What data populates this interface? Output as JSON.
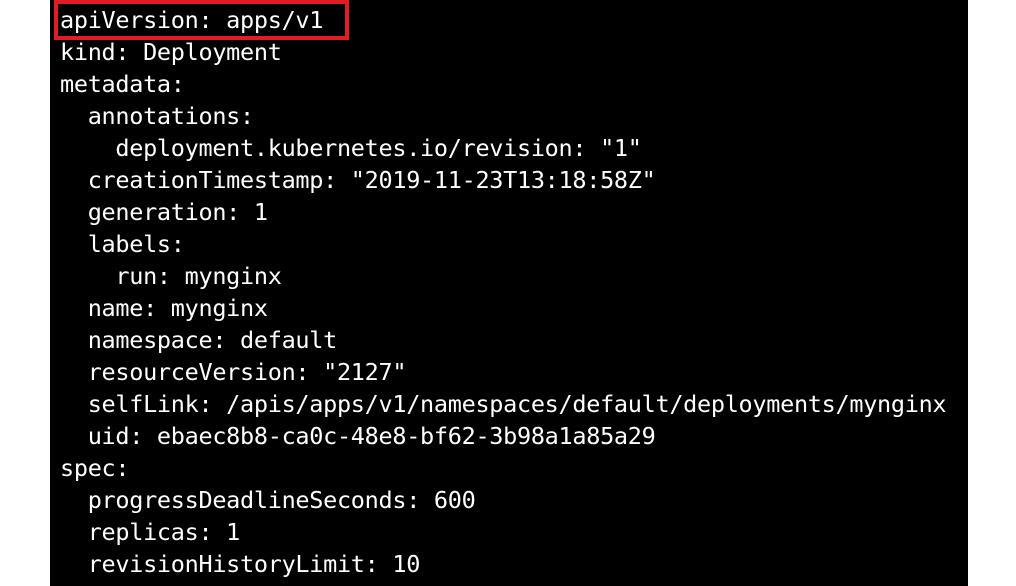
{
  "terminal": {
    "highlight_color": "#e01c24",
    "lines": [
      "apiVersion: apps/v1",
      "kind: Deployment",
      "metadata:",
      "  annotations:",
      "    deployment.kubernetes.io/revision: \"1\"",
      "  creationTimestamp: \"2019-11-23T13:18:58Z\"",
      "  generation: 1",
      "  labels:",
      "    run: mynginx",
      "  name: mynginx",
      "  namespace: default",
      "  resourceVersion: \"2127\"",
      "  selfLink: /apis/apps/v1/namespaces/default/deployments/mynginx",
      "  uid: ebaec8b8-ca0c-48e8-bf62-3b98a1a85a29",
      "spec:",
      "  progressDeadlineSeconds: 600",
      "  replicas: 1",
      "  revisionHistoryLimit: 10"
    ]
  }
}
